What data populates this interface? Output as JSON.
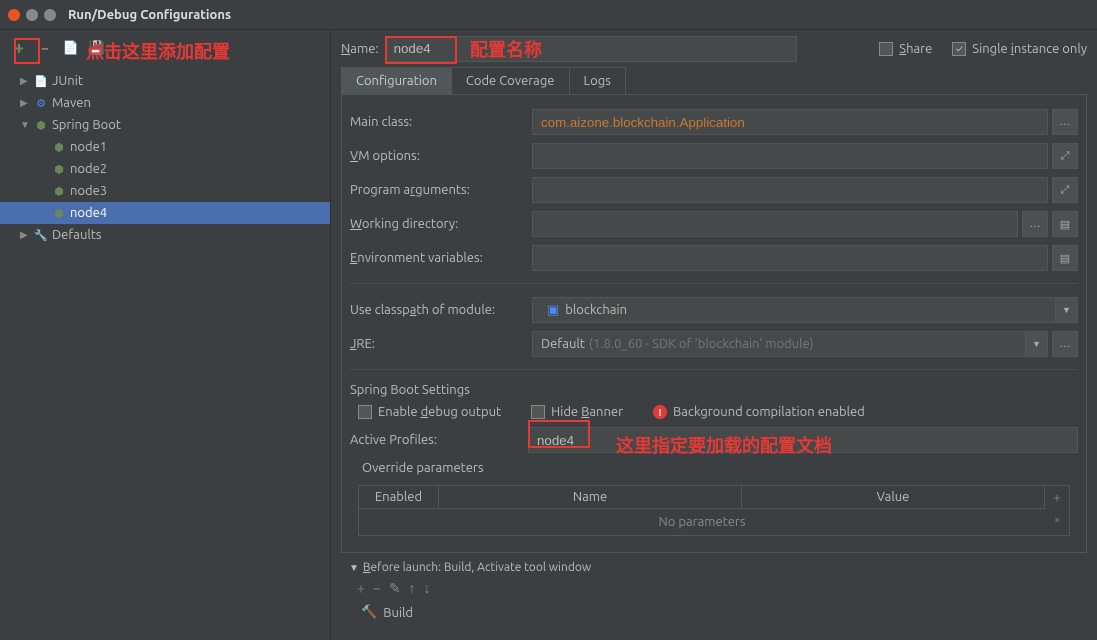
{
  "window": {
    "title": "Run/Debug Configurations"
  },
  "annotations": {
    "add_here": "点击这里添加配置",
    "config_name": "配置名称",
    "load_profile": "这里指定要加载的配置文档"
  },
  "sidebar": {
    "items": [
      {
        "label": "JUnit",
        "icon": "junit",
        "expandable": true,
        "expanded": false
      },
      {
        "label": "Maven",
        "icon": "maven",
        "expandable": true,
        "expanded": false
      },
      {
        "label": "Spring Boot",
        "icon": "spring",
        "expandable": true,
        "expanded": true
      },
      {
        "label": "Defaults",
        "icon": "defaults",
        "expandable": true,
        "expanded": false
      }
    ],
    "spring_nodes": [
      {
        "label": "node1"
      },
      {
        "label": "node2"
      },
      {
        "label": "node3"
      },
      {
        "label": "node4",
        "selected": true
      }
    ]
  },
  "top": {
    "name_label": "Name:",
    "name_value": "node4",
    "share_label": "Share",
    "single_instance_label": "Single instance only",
    "single_instance_checked": true
  },
  "tabs": [
    {
      "label": "Configuration",
      "active": true
    },
    {
      "label": "Code Coverage"
    },
    {
      "label": "Logs"
    }
  ],
  "form": {
    "main_class_label": "Main class:",
    "main_class_value": "com.aizone.blockchain.Application",
    "vm_options_label": "VM options:",
    "vm_options_value": "",
    "program_args_label": "Program arguments:",
    "program_args_value": "",
    "working_dir_label": "Working directory:",
    "working_dir_value": "",
    "env_vars_label": "Environment variables:",
    "env_vars_value": "",
    "classpath_label": "Use classpath of module:",
    "classpath_value": "blockchain",
    "jre_label": "JRE:",
    "jre_value": "Default",
    "jre_hint": "(1.8.0_60 - SDK of 'blockchain' module)"
  },
  "spring_settings": {
    "title": "Spring Boot Settings",
    "enable_debug_label": "Enable debug output",
    "hide_banner_label": "Hide Banner",
    "bg_compilation_label": "Background compilation enabled",
    "active_profiles_label": "Active Profiles:",
    "active_profiles_value": "node4",
    "override_params_label": "Override parameters",
    "cols": {
      "enabled": "Enabled",
      "name": "Name",
      "value": "Value"
    },
    "no_params": "No parameters"
  },
  "before_launch": {
    "title": "Before launch: Build, Activate tool window",
    "build_label": "Build"
  }
}
